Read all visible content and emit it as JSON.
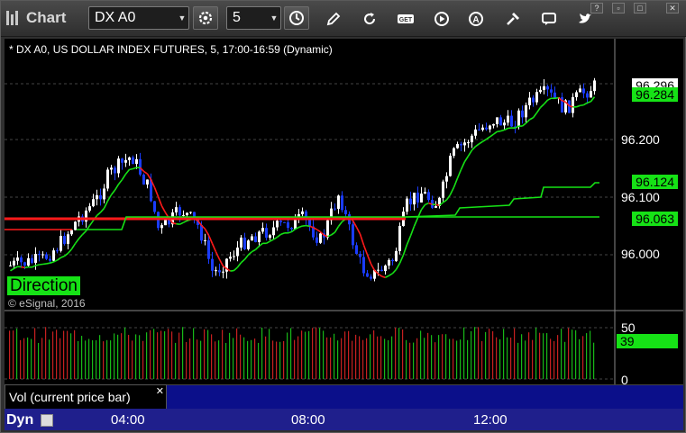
{
  "app": {
    "title": "Chart"
  },
  "toolbar": {
    "symbol": "DX A0",
    "interval": "5",
    "icons": [
      "settings-icon",
      "clock-icon",
      "draw-pencil-icon",
      "refresh-icon",
      "get-icon",
      "play-icon",
      "alert-icon",
      "tools-icon",
      "comment-icon",
      "twitter-icon"
    ]
  },
  "window_controls": [
    "?",
    "▫",
    "□",
    "✕"
  ],
  "chart": {
    "info_line": "* DX A0, US DOLLAR INDEX FUTURES, 5, 17:00-16:59 (Dynamic)",
    "direction_label": "Direction",
    "copyright": "© eSignal, 2016",
    "price_axis_ticks": [
      "96.200",
      "96.100",
      "96.000"
    ],
    "price_labels": [
      {
        "value": "96.296",
        "bg": "#ffffff",
        "fg": "#000000"
      },
      {
        "value": "96.284",
        "bg": "#16e216",
        "fg": "#000000"
      },
      {
        "value": "96.124",
        "bg": "#16e216",
        "fg": "#000000"
      },
      {
        "value": "96.063",
        "bg": "#16e216",
        "fg": "#000000"
      }
    ],
    "colors": {
      "up_candle": "#ffffff",
      "down_candle": "#1a3cff",
      "ma_line": "#16e216",
      "ichimoku_line": "#16e216",
      "red_line": "#ff1a1a"
    }
  },
  "volume": {
    "tab_label": "Vol (current price bar)",
    "axis_ticks": [
      "50",
      "0"
    ],
    "current_value": "39"
  },
  "time_axis": {
    "mode": "Dyn",
    "labels": [
      "04:00",
      "08:00",
      "12:00"
    ]
  }
}
